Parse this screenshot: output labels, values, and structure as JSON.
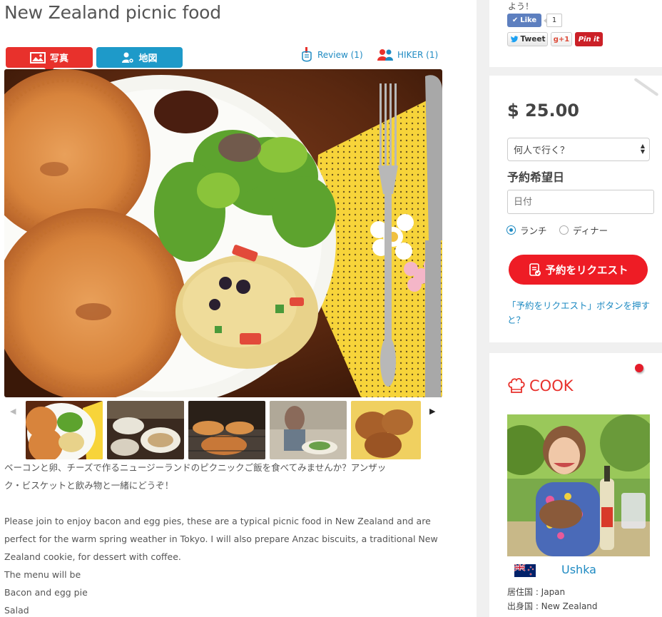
{
  "page": {
    "title": "New Zealand picnic food"
  },
  "tabs": {
    "photo_label": "写真",
    "map_label": "地図"
  },
  "links": {
    "review": "Review (1)",
    "hiker": "HIKER (1)"
  },
  "gallery": {
    "main_photo_alt": "New Zealand picnic food",
    "thumbnail_count": 5
  },
  "description": {
    "jp_line1": "ベーコンと卵、チーズで作るニュージーランドのピクニックご飯を食べてみませんか？アンザッ",
    "jp_line2": "ク・ビスケットと飲み物と一緒にどうぞ！",
    "en_line1": "Please join to enjoy bacon and egg pies, these are a typical picnic food in New Zealand and are",
    "en_line2": "perfect for the warm spring weather in Tokyo. I will also prepare Anzac biscuits, a traditional New",
    "en_line3": "Zealand cookie, for dessert with coffee.",
    "en_line4": "The menu will be",
    "en_line5": "Bacon and egg pie",
    "en_line6": "Salad"
  },
  "social": {
    "text": "よう！",
    "like_label": "Like",
    "like_count": "1",
    "tweet_label": "Tweet",
    "gplus_label": "g+1",
    "pin_label": "Pin it"
  },
  "booking": {
    "price": "$ 25.00",
    "people_select": "何人で行く？",
    "date_heading": "予約希望日",
    "date_placeholder": "日付",
    "lunch_label": "ランチ",
    "dinner_label": "ディナー",
    "selected_meal": "lunch",
    "request_button": "予約をリクエスト",
    "help_link": "「予約をリクエスト」ボタンを押すと？"
  },
  "cook": {
    "heading": "COOK",
    "name": "Ushka",
    "residence": "居住国 : Japan",
    "origin": "出身国 : New Zealand"
  },
  "colors": {
    "accent_red": "#e8312c",
    "accent_blue": "#1e9ac9",
    "link_blue": "#1e8ac2"
  }
}
